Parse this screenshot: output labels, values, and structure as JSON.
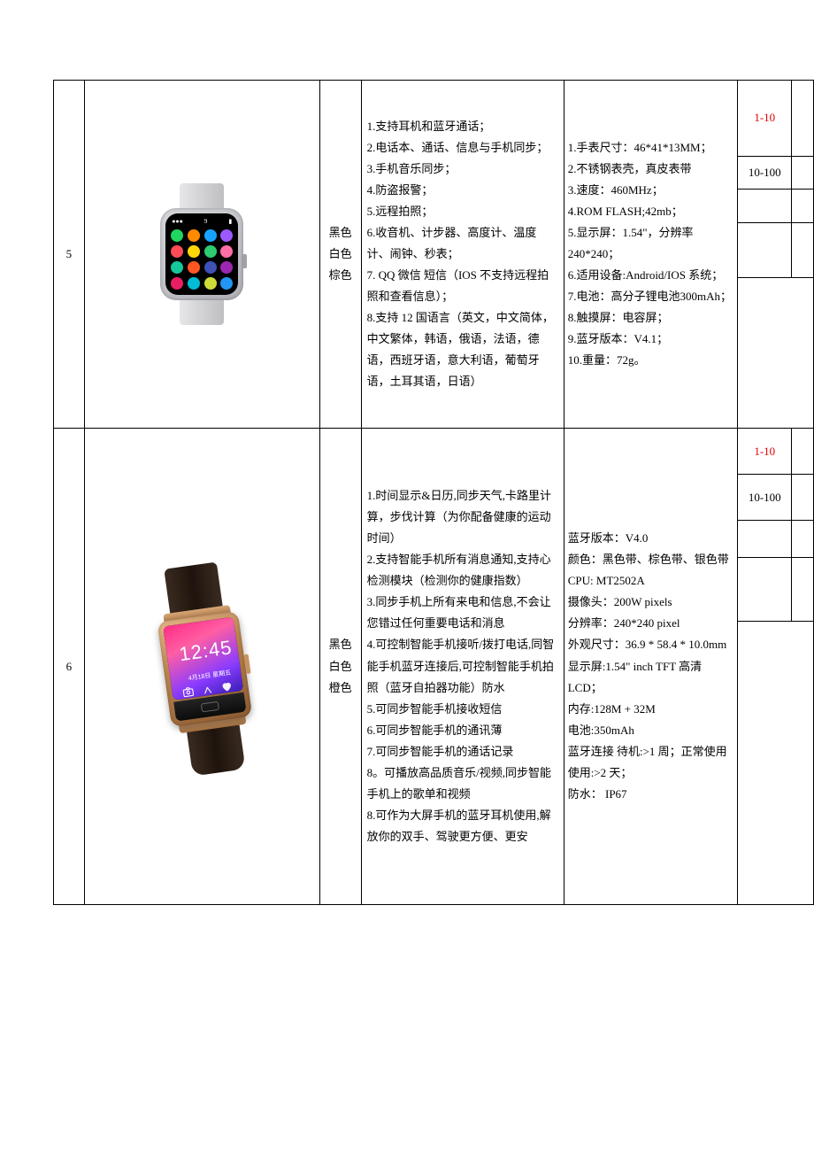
{
  "rows": [
    {
      "id": "5",
      "color": "黑色\n白色\n棕色",
      "features": "1.支持耳机和蓝牙通话；\n2.电话本、通话、信息与手机同步；\n3.手机音乐同步；\n4.防盗报警；\n5.远程拍照；\n6.收音机、计步器、高度计、温度计、闹钟、秒表；\n7. QQ 微信 短信（IOS 不支持远程拍照和查看信息）；\n8.支持 12 国语言（英文，中文简体，中文繁体，韩语，俄语，法语，德语，西班牙语，意大利语，葡萄牙语，土耳其语，日语）",
      "specs": "1.手表尺寸：46*41*13MM；\n2.不锈钢表壳，真皮表带\n3.速度：460MHz；\n4.ROM   FLASH;42mb；\n5.显示屏：1.54\"，分辨率240*240；\n6.适用设备:Android/IOS 系统；\n7.电池：高分子锂电池300mAh；\n8.触摸屏：电容屏；\n9.蓝牙版本：V4.1；\n10.重量：72g。",
      "qty": [
        "1-10",
        "10-100"
      ],
      "watch_time": "9"
    },
    {
      "id": "6",
      "color": "黑色\n白色\n橙色",
      "features": "1.时间显示&日历,同步天气,卡路里计算，步伐计算（为你配备健康的运动时间）\n2.支持智能手机所有消息通知,支持心检测模块（检测你的健康指数）\n3.同步手机上所有来电和信息,不会让您错过任何重要电话和消息\n4.可控制智能手机接听/拨打电话,同智能手机蓝牙连接后,可控制智能手机拍照（蓝牙自拍器功能）防水\n5.可同步智能手机接收短信\n6.可同步智能手机的通讯薄\n7.可同步智能手机的通话记录\n8。可播放高品质音乐/视频,同步智能手机上的歌单和视频\n8.可作为大屏手机的蓝牙耳机使用,解放你的双手、驾驶更方便、更安",
      "specs": "蓝牙版本：V4.0\n颜色：黑色带、棕色带、银色带\nCPU: MT2502A\n摄像头：200W pixels\n分辨率：240*240 pixel\n外观尺寸：36.9 * 58.4 * 10.0mm\n显示屏:1.54\"  inch TFT 高清 LCD；\n内存:128M + 32M\n电池:350mAh\n蓝牙连接 待机:>1 周；正常使用 使用:>2 天；\n防水： IP67",
      "qty": [
        "1-10",
        "10-100"
      ],
      "watch_time": "12:45",
      "watch_date": "4月18日 星期五"
    }
  ]
}
